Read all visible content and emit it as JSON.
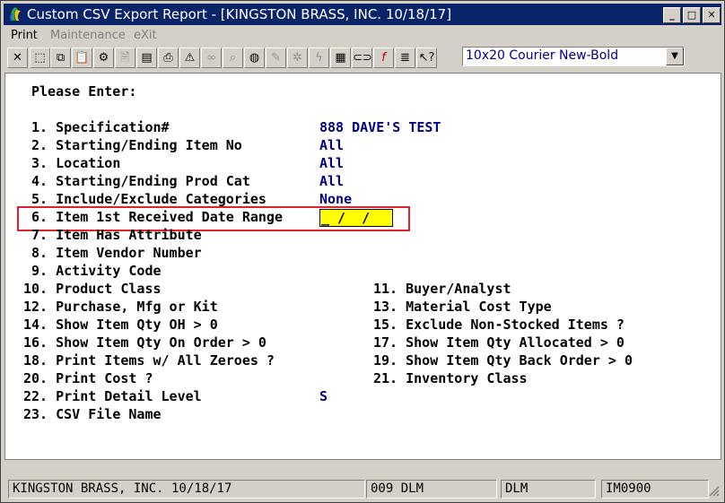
{
  "window": {
    "title": "Custom CSV Export Report - [KINGSTON BRASS, INC. 10/18/17]",
    "minimize": "_",
    "maximize": "□",
    "close": "✕"
  },
  "menu": {
    "print": "Print",
    "maintenance": "Maintenance",
    "exit": "eXit"
  },
  "toolbar": {
    "font_select": "10x20 Courier New-Bold"
  },
  "screen": {
    "prompt": "Please Enter:",
    "spec_label": " 1. Specification#",
    "spec_value": "888 DAVE'S TEST",
    "item_label": " 2. Starting/Ending Item No",
    "item_value": "All",
    "loc_label": " 3. Location",
    "loc_value": "All",
    "prodcat_label": " 4. Starting/Ending Prod Cat",
    "prodcat_value": "All",
    "incexc_label": " 5. Include/Exclude Categories",
    "incexc_value": "None",
    "recv_label": " 6. Item 1st Received Date Range",
    "recv_value": "_ /  /",
    "attr_label": " 7. Item Has Attribute",
    "vendor_label": " 8. Item Vendor Number",
    "activity_label": " 9. Activity Code",
    "prodclass_label": "10. Product Class",
    "buyer_label": "11. Buyer/Analyst",
    "pmk_label": "12. Purchase, Mfg or Kit",
    "matcost_label": "13. Material Cost Type",
    "qtyoh_label": "14. Show Item Qty OH > 0",
    "nonstock_label": "15. Exclude Non-Stocked Items ?",
    "onorder_label": "16. Show Item Qty On Order > 0",
    "allocated_label": "17. Show Item Qty Allocated > 0",
    "zeroes_label": "18. Print Items w/ All Zeroes ?",
    "backorder_label": "19. Show Item Qty Back Order > 0",
    "printcost_label": "20. Print Cost ?",
    "invclass_label": "21. Inventory Class",
    "detail_label": "22. Print Detail Level",
    "detail_value": "S",
    "csv_label": "23. CSV File Name"
  },
  "status": {
    "company": "KINGSTON BRASS, INC. 10/18/17",
    "session": "009 DLM",
    "user": "DLM",
    "program": "IM0900"
  },
  "colors": {
    "titlebar": "#0a246a",
    "highlight_border": "#e0202a",
    "date_field": "#ffff00",
    "value_text": "#000080"
  }
}
